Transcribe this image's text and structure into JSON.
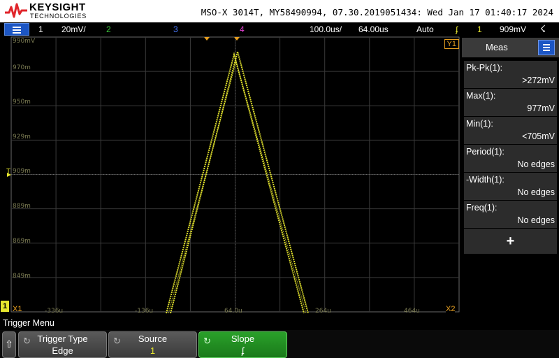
{
  "banner": {
    "brand": "KEYSIGHT",
    "brand_sub": "TECHNOLOGIES",
    "model_line": "MSO-X 3014T, MY58490994, 07.30.2019051434: Wed Jan 17 01:40:17 2024"
  },
  "channel_bar": {
    "ch1": "1",
    "ch1_scale": "20mV/",
    "ch2": "2",
    "ch3": "3",
    "ch4": "4",
    "timebase": "100.0us/",
    "delay": "64.00us",
    "trigger_mode": "Auto",
    "trigger_slope_symbol": "ʄ",
    "trigger_source": "1",
    "trigger_level": "909mV"
  },
  "graticule": {
    "y_labels": [
      "990mV",
      "970m",
      "950m",
      "929m",
      "909m",
      "889m",
      "869m",
      "849m"
    ],
    "x_labels": [
      "-336u",
      "-136u",
      "64.0u",
      "264u",
      "464u"
    ],
    "y1_marker": "Y1",
    "x1_marker": "X1",
    "x2_marker": "X2",
    "ch1_ground_marker": "1",
    "trigger_marker": "T",
    "trace_color": "#e6e62e"
  },
  "meas_panel": {
    "title": "Meas",
    "items": [
      {
        "name": "Pk-Pk(1):",
        "value": ">272mV"
      },
      {
        "name": "Max(1):",
        "value": "977mV"
      },
      {
        "name": "Min(1):",
        "value": "<705mV"
      },
      {
        "name": "Period(1):",
        "value": "No edges"
      },
      {
        "name": "-Width(1):",
        "value": "No edges"
      },
      {
        "name": "Freq(1):",
        "value": "No edges"
      }
    ],
    "add_label": "+"
  },
  "softkeys": {
    "menu_title": "Trigger Menu",
    "back": "⇧",
    "trigger_type_label": "Trigger Type",
    "trigger_type_value": "Edge",
    "source_label": "Source",
    "source_value": "1",
    "slope_label": "Slope",
    "slope_value": "ʄ"
  },
  "colors": {
    "ch1": "#e6e62e",
    "ch2": "#3cc83c",
    "ch3": "#4a7bff",
    "ch4": "#e040d0",
    "slope_button": "#1e8a1e"
  }
}
